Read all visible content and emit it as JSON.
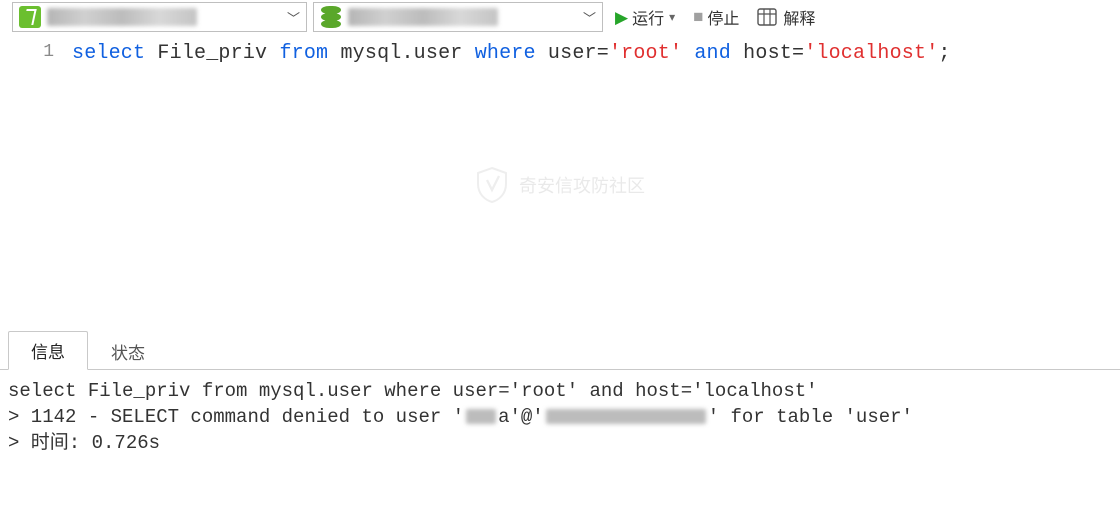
{
  "toolbar": {
    "run_label": "运行",
    "stop_label": "停止",
    "explain_label": "解释"
  },
  "editor": {
    "line_number": "1",
    "sql": {
      "kw_select": "select",
      "col": " File_priv ",
      "kw_from": "from",
      "tbl": " mysql.user ",
      "kw_where": "where",
      "cond1_lhs": " user=",
      "cond1_rhs": "'root'",
      "kw_and": " and ",
      "cond2_lhs": "host=",
      "cond2_rhs": "'localhost'",
      "tail": ";"
    }
  },
  "watermark_text": "奇安信攻防社区",
  "tabs": {
    "active": "信息",
    "inactive": "状态"
  },
  "output": {
    "line1": "select File_priv from mysql.user where user='root' and host='localhost'",
    "line2_a": "> 1142 - SELECT command denied to user '",
    "line2_b": "a'@'",
    "line2_c": "' for table 'user'",
    "line3": "> 时间: 0.726s"
  }
}
